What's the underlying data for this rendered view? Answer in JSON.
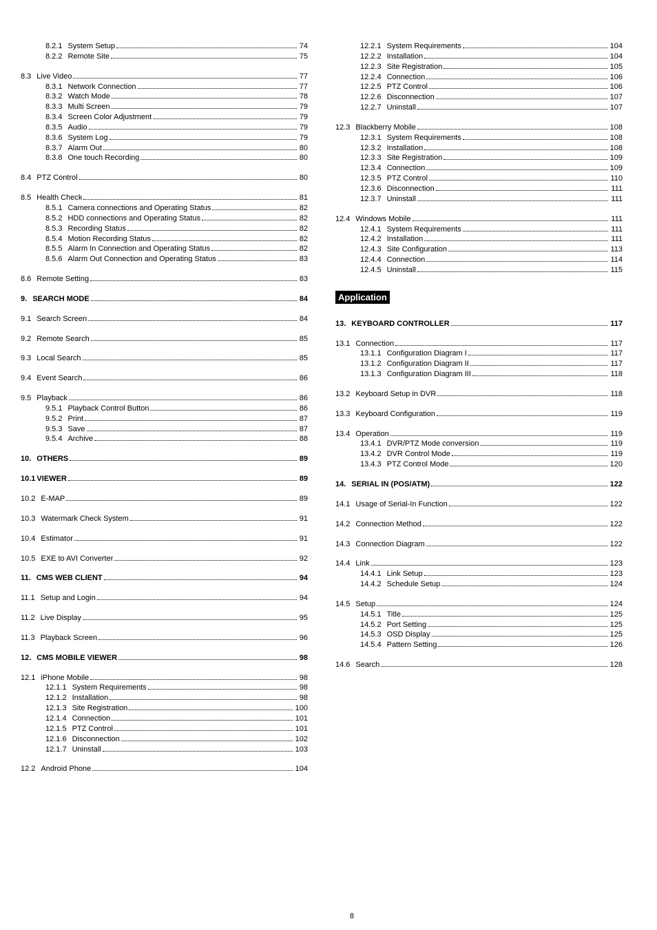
{
  "pageNumber": "8",
  "sectionHeader": "Application",
  "left": [
    {
      "lvl": 4,
      "num": "8.2.1",
      "title": "System Setup",
      "page": "74"
    },
    {
      "lvl": 4,
      "num": "8.2.2",
      "title": "Remote Site",
      "page": "75"
    },
    {
      "lvl": 2,
      "num": "8.3",
      "title": "Live Video",
      "page": "77"
    },
    {
      "lvl": 4,
      "num": "8.3.1",
      "title": "Network Connection",
      "page": "77"
    },
    {
      "lvl": 4,
      "num": "8.3.2",
      "title": "Watch Mode",
      "page": "78"
    },
    {
      "lvl": 4,
      "num": "8.3.3",
      "title": "Multi Screen",
      "page": "79"
    },
    {
      "lvl": 4,
      "num": "8.3.4",
      "title": "Screen Color Adjustment",
      "page": "79"
    },
    {
      "lvl": 4,
      "num": "8.3.5",
      "title": "Audio",
      "page": "79"
    },
    {
      "lvl": 4,
      "num": "8.3.6",
      "title": "System Log",
      "page": "79"
    },
    {
      "lvl": 4,
      "num": "8.3.7",
      "title": "Alarm Out",
      "page": "80"
    },
    {
      "lvl": 4,
      "num": "8.3.8",
      "title": "One touch Recording",
      "page": "80"
    },
    {
      "lvl": 2,
      "num": "8.4",
      "title": "PTZ Control",
      "page": "80"
    },
    {
      "lvl": 2,
      "num": "8.5",
      "title": "Health Check",
      "page": "81"
    },
    {
      "lvl": 4,
      "num": "8.5.1",
      "title": "Camera connections and Operating Status",
      "page": "82"
    },
    {
      "lvl": 4,
      "num": "8.5.2",
      "title": "HDD connections and Operating Status",
      "page": "82"
    },
    {
      "lvl": 4,
      "num": "8.5.3",
      "title": "Recording Status",
      "page": "82"
    },
    {
      "lvl": 4,
      "num": "8.5.4",
      "title": "Motion Recording Status",
      "page": "82"
    },
    {
      "lvl": 4,
      "num": "8.5.5",
      "title": "Alarm In Connection and Operating Status",
      "page": "82"
    },
    {
      "lvl": 4,
      "num": "8.5.6",
      "title": "Alarm Out Connection and Operating Status",
      "page": "83"
    },
    {
      "lvl": 2,
      "num": "8.6",
      "title": "Remote Setting",
      "page": "83"
    },
    {
      "lvl": 1,
      "num": "9.",
      "title": "SEARCH MODE",
      "page": "84"
    },
    {
      "lvl": 2,
      "num": "9.1",
      "title": "Search Screen",
      "page": "84"
    },
    {
      "lvl": 2,
      "num": "9.2",
      "title": "Remote Search",
      "page": "85"
    },
    {
      "lvl": 2,
      "num": "9.3",
      "title": "Local Search",
      "page": "85"
    },
    {
      "lvl": 2,
      "num": "9.4",
      "title": "Event Search",
      "page": "86"
    },
    {
      "lvl": 2,
      "num": "9.5",
      "title": "Playback",
      "page": "86"
    },
    {
      "lvl": 4,
      "num": "9.5.1",
      "title": "Playback Control Button",
      "page": "86"
    },
    {
      "lvl": 4,
      "num": "9.5.2",
      "title": "Print",
      "page": "87"
    },
    {
      "lvl": 4,
      "num": "9.5.3",
      "title": "Save",
      "page": "87"
    },
    {
      "lvl": 4,
      "num": "9.5.4",
      "title": "Archive",
      "page": "88"
    },
    {
      "lvl": 1,
      "num": "10.",
      "title": "OTHERS",
      "page": "89"
    },
    {
      "lvl": 1,
      "num": "10.1",
      "title": "VIEWER",
      "page": "89",
      "flushNum": true
    },
    {
      "lvl": 2,
      "num": "10.2",
      "title": "E-MAP",
      "page": "89"
    },
    {
      "lvl": 2,
      "num": "10.3",
      "title": "Watermark Check System",
      "page": "91"
    },
    {
      "lvl": 2,
      "num": "10.4",
      "title": "Estimator",
      "page": "91"
    },
    {
      "lvl": 2,
      "num": "10.5",
      "title": "EXE to AVI Converter",
      "page": "92"
    },
    {
      "lvl": 1,
      "num": "11.",
      "title": "CMS WEB CLIENT",
      "page": "94"
    },
    {
      "lvl": 2,
      "num": "11.1",
      "title": "Setup and Login",
      "page": "94"
    },
    {
      "lvl": 2,
      "num": "11.2",
      "title": "Live Display",
      "page": "95"
    },
    {
      "lvl": 2,
      "num": "11.3",
      "title": "Playback Screen",
      "page": "96"
    },
    {
      "lvl": 1,
      "num": "12.",
      "title": "CMS MOBILE VIEWER",
      "page": "98"
    },
    {
      "lvl": 2,
      "num": "12.1",
      "title": "iPhone Mobile",
      "page": "98"
    },
    {
      "lvl": 4,
      "num": "12.1.1",
      "title": "System Requirements",
      "page": "98"
    },
    {
      "lvl": 4,
      "num": "12.1.2",
      "title": "Installation",
      "page": "98"
    },
    {
      "lvl": 4,
      "num": "12.1.3",
      "title": "Site Registration",
      "page": "100"
    },
    {
      "lvl": 4,
      "num": "12.1.4",
      "title": "Connection",
      "page": "101"
    },
    {
      "lvl": 4,
      "num": "12.1.5",
      "title": "PTZ Control",
      "page": "101"
    },
    {
      "lvl": 4,
      "num": "12.1.6",
      "title": "Disconnection",
      "page": "102"
    },
    {
      "lvl": 4,
      "num": "12.1.7",
      "title": "Uninstall",
      "page": "103"
    },
    {
      "lvl": 2,
      "num": "12.2",
      "title": "Android Phone",
      "page": "104"
    }
  ],
  "right": [
    {
      "lvl": 4,
      "num": "12.2.1",
      "title": "System Requirements",
      "page": "104"
    },
    {
      "lvl": 4,
      "num": "12.2.2",
      "title": "Installation",
      "page": "104"
    },
    {
      "lvl": 4,
      "num": "12.2.3",
      "title": "Site Registration",
      "page": "105"
    },
    {
      "lvl": 4,
      "num": "12.2.4",
      "title": "Connection",
      "page": "106"
    },
    {
      "lvl": 4,
      "num": "12.2.5",
      "title": "PTZ Control",
      "page": "106"
    },
    {
      "lvl": 4,
      "num": "12.2.6",
      "title": "Disconnection",
      "page": "107"
    },
    {
      "lvl": 4,
      "num": "12.2.7",
      "title": "Uninstall",
      "page": "107"
    },
    {
      "lvl": 2,
      "num": "12.3",
      "title": "Blackberry Mobile",
      "page": "108"
    },
    {
      "lvl": 4,
      "num": "12.3.1",
      "title": "System Requirements",
      "page": "108"
    },
    {
      "lvl": 4,
      "num": "12.3.2",
      "title": "Installation",
      "page": "108"
    },
    {
      "lvl": 4,
      "num": "12.3.3",
      "title": "Site Registration",
      "page": "109"
    },
    {
      "lvl": 4,
      "num": "12.3.4",
      "title": "Connection",
      "page": "109"
    },
    {
      "lvl": 4,
      "num": "12.3.5",
      "title": "PTZ Control",
      "page": "110"
    },
    {
      "lvl": 4,
      "num": "12.3.6",
      "title": "Disconnection",
      "page": "111"
    },
    {
      "lvl": 4,
      "num": "12.3.7",
      "title": "Uninstall",
      "page": "111"
    },
    {
      "lvl": 2,
      "num": "12.4",
      "title": "Windows Mobile",
      "page": "111"
    },
    {
      "lvl": 4,
      "num": "12.4.1",
      "title": "System Requirements",
      "page": "111"
    },
    {
      "lvl": 4,
      "num": "12.4.2",
      "title": "Installation",
      "page": "111"
    },
    {
      "lvl": 4,
      "num": "12.4.3",
      "title": "Site Configuration",
      "page": "113"
    },
    {
      "lvl": 4,
      "num": "12.4.4",
      "title": "Connection",
      "page": "114"
    },
    {
      "lvl": 4,
      "num": "12.4.5",
      "title": "Uninstall",
      "page": "115"
    },
    {
      "section": true
    },
    {
      "lvl": 1,
      "num": "13.",
      "title": "KEYBOARD CONTROLLER",
      "page": "117"
    },
    {
      "lvl": 2,
      "num": "13.1",
      "title": "Connection",
      "page": "117"
    },
    {
      "lvl": 4,
      "num": "13.1.1",
      "title": "Configuration Diagram I",
      "page": "117"
    },
    {
      "lvl": 4,
      "num": "13.1.2",
      "title": "Configuration Diagram II",
      "page": "117"
    },
    {
      "lvl": 4,
      "num": "13.1.3",
      "title": "Configuration Diagram III",
      "page": "118"
    },
    {
      "lvl": 2,
      "num": "13.2",
      "title": "Keyboard Setup in DVR",
      "page": "118"
    },
    {
      "lvl": 2,
      "num": "13.3",
      "title": "Keyboard Configuration",
      "page": "119"
    },
    {
      "lvl": 2,
      "num": "13.4",
      "title": "Operation",
      "page": "119"
    },
    {
      "lvl": 4,
      "num": "13.4.1",
      "title": "DVR/PTZ Mode conversion",
      "page": "119"
    },
    {
      "lvl": 4,
      "num": "13.4.2",
      "title": "DVR Control Mode",
      "page": "119"
    },
    {
      "lvl": 4,
      "num": "13.4.3",
      "title": "PTZ Control Mode",
      "page": "120"
    },
    {
      "lvl": 1,
      "num": "14.",
      "title": "SERIAL IN (POS/ATM)",
      "page": "122"
    },
    {
      "lvl": 2,
      "num": "14.1",
      "title": "Usage of Serial-In Function",
      "page": "122"
    },
    {
      "lvl": 2,
      "num": "14.2",
      "title": "Connection Method",
      "page": "122"
    },
    {
      "lvl": 2,
      "num": "14.3",
      "title": "Connection Diagram",
      "page": "122"
    },
    {
      "lvl": 2,
      "num": "14.4",
      "title": "Link",
      "page": "123"
    },
    {
      "lvl": 4,
      "num": "14.4.1",
      "title": "Link Setup",
      "page": "123"
    },
    {
      "lvl": 4,
      "num": "14.4.2",
      "title": "Schedule Setup",
      "page": "124"
    },
    {
      "lvl": 2,
      "num": "14.5",
      "title": "Setup",
      "page": "124"
    },
    {
      "lvl": 4,
      "num": "14.5.1",
      "title": "Title",
      "page": "125"
    },
    {
      "lvl": 4,
      "num": "14.5.2",
      "title": "Port Setting",
      "page": "125"
    },
    {
      "lvl": 4,
      "num": "14.5.3",
      "title": "OSD Display",
      "page": "125"
    },
    {
      "lvl": 4,
      "num": "14.5.4",
      "title": "Pattern Setting",
      "page": "126"
    },
    {
      "lvl": 2,
      "num": "14.6",
      "title": "Search",
      "page": "128"
    }
  ]
}
